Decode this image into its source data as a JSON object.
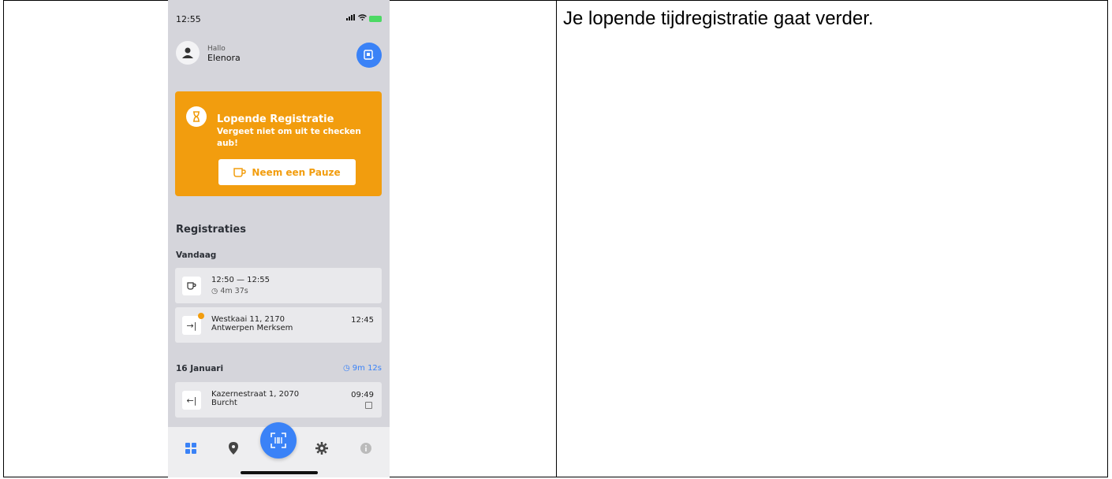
{
  "caption": "Je lopende tijdregistratie gaat verder.",
  "status_bar": {
    "time": "12:55",
    "signal": "signal-icon",
    "wifi": "wifi-icon",
    "battery": "battery-icon"
  },
  "header": {
    "greeting": "Hallo",
    "user_name": "Elenora"
  },
  "running_card": {
    "title": "Lopende Registratie",
    "subtitle": "Vergeet niet om uit te checken aub!",
    "pause_button": "Neem een Pauze",
    "color": "#f29d0e"
  },
  "registrations": {
    "title": "Registraties",
    "groups": [
      {
        "label": "Vandaag",
        "items": [
          {
            "type": "pause",
            "time_range": "12:50  —  12:55",
            "duration": "4m 37s"
          },
          {
            "type": "check-in",
            "address": "Westkaai 11, 2170",
            "city": "Antwerpen Merksem",
            "time": "12:45"
          }
        ]
      },
      {
        "label": "16 Januari",
        "total": "9m 12s",
        "items": [
          {
            "type": "check-out",
            "address": "Kazernestraat 1, 2070",
            "city": "Burcht",
            "time": "09:49"
          }
        ]
      }
    ]
  },
  "accent_color": "#3a82f7"
}
